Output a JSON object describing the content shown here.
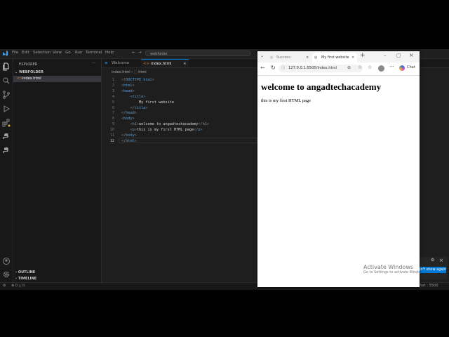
{
  "vscode": {
    "menu": [
      "File",
      "Edit",
      "Selection",
      "View",
      "Go",
      "Run",
      "Terminal",
      "Help"
    ],
    "search_text": "webfolder",
    "explorer_title": "EXPLORER",
    "folder_name": "WEBFOLDER",
    "file_name": "index.html",
    "outline_label": "OUTLINE",
    "timeline_label": "TIMELINE",
    "tabs": [
      {
        "label": "Welcome"
      },
      {
        "label": "index.html"
      }
    ],
    "breadcrumb": {
      "file": "index.html",
      "node": "html"
    },
    "code_lines": [
      {
        "n": "1",
        "text": "<!DOCTYPE html>"
      },
      {
        "n": "2",
        "text": "<html>"
      },
      {
        "n": "3",
        "text": "<head>"
      },
      {
        "n": "4",
        "text": "    <title>"
      },
      {
        "n": "5",
        "text": "        My first website"
      },
      {
        "n": "6",
        "text": "    </title>"
      },
      {
        "n": "7",
        "text": "</head>"
      },
      {
        "n": "8",
        "text": "<body>"
      },
      {
        "n": "9",
        "text": "    <h1>welcome to angadtechacademy</h1>"
      },
      {
        "n": "10",
        "text": "    <p>this is my first HTML page</p>"
      },
      {
        "n": "11",
        "text": "</body>"
      },
      {
        "n": "12",
        "text": "</html>"
      }
    ],
    "status": {
      "problems": "0",
      "warnings": "0",
      "port_text": "Port : 5500"
    },
    "notification_button": "Don't show again"
  },
  "browser": {
    "tabs": [
      {
        "label": "Success"
      },
      {
        "label": "My first website"
      }
    ],
    "url": "127.0.0.1:5500/index.html",
    "chat_label": "Chat",
    "page": {
      "heading": "welcome to angadtechacademy",
      "paragraph": "this is my first HTML page"
    }
  },
  "watermark": {
    "line1": "Activate Windows",
    "line2": "Go to Settings to activate Windows."
  },
  "colors": {
    "editor_bg": "#1e1e1e",
    "sidebar_bg": "#181818",
    "accent": "#0078d4",
    "tag_blue": "#569cd6"
  }
}
